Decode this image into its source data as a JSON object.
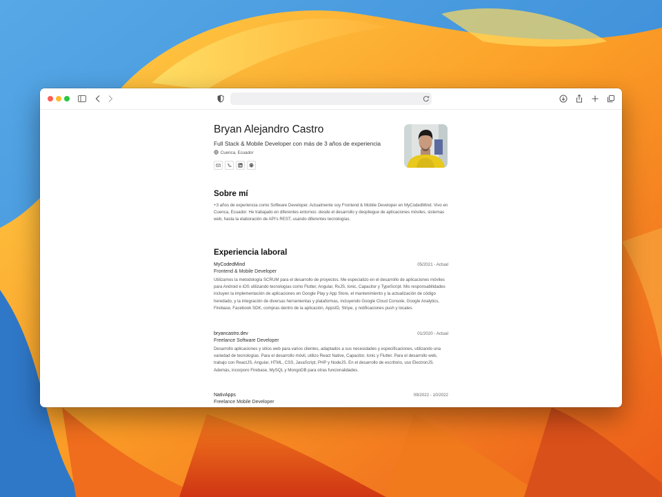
{
  "profile": {
    "name": "Bryan Alejandro Castro",
    "tagline": "Full Stack & Mobile Developer con más de 3 años de experiencia",
    "location": "Cuenca, Ecuador",
    "contact_icons": [
      "mail-icon",
      "phone-icon",
      "linkedin-icon",
      "github-icon"
    ]
  },
  "about": {
    "heading": "Sobre mí",
    "text": "+3 años de experiencia como Software Developer. Actualmente soy Frontend & Mobile Developer en MyCodedMind. Vivo en Cuenca, Ecuador. He trabajado en diferentes entornos: desde el desarrollo y despliegue de aplicaciones móviles, sistemas web, hasta la elaboración de API's REST, usando diferentes tecnologías."
  },
  "experience": {
    "heading": "Experiencia laboral",
    "jobs": [
      {
        "company": "MyCodedMind",
        "date": "05/2021 - Actual",
        "role": "Frontend & Mobile Developer",
        "description": "Utilizamos la metodología SCRUM para el desarrollo de proyectos. Me especializo en el desarrollo de aplicaciones móviles para Android e iOS utilizando tecnologías como Flutter, Angular, RxJS, Ionic, Capacitor y TypeScript. Mis responsabilidades incluyen la implementación de aplicaciones en Google Play y App Store, el mantenimiento y la actualización de código heredado, y la integración de diversas herramientas y plataformas, incluyendo Google Cloud Console, Google Analytics, Firebase, Facebook SDK, compras dentro de la aplicación, AppsID, Stripe, y notificaciones push y locales."
      },
      {
        "company": "bryancastro.dev",
        "date": "01/2020 - Actual",
        "role": "Freelance Software Developer",
        "description": "Desarrollo aplicaciones y sitios web para varios clientes, adaptados a sus necesidades y especificaciones, utilizando una variedad de tecnologías. Para el desarrollo móvil, utilizo React Native, Capacitor, Ionic y Flutter. Para el desarrollo web, trabajo con ReactJS, Angular, HTML, CSS, JavaScript, PHP y NodeJS. En el desarrollo de escritorio, uso ElectronJS. Además, incorporo Firebase, MySQL y MongoDB para otras funcionalidades."
      },
      {
        "company": "NativApps",
        "date": "09/2022 - 10/2022",
        "role": "Freelance Mobile Developer",
        "description": ""
      }
    ]
  },
  "browser": {
    "address_text": "",
    "toolbar_icons": [
      "sidebar-icon",
      "back-icon",
      "forward-icon",
      "privacy-shield-icon",
      "reload-icon",
      "download-icon",
      "share-icon",
      "new-tab-icon",
      "tabs-overview-icon"
    ]
  },
  "colors": {
    "close": "#ff5f57",
    "minimize": "#febc2e",
    "zoom": "#28c840",
    "wallpaper_blue": "#3a8fdc",
    "wallpaper_orange": "#f28a1a"
  }
}
